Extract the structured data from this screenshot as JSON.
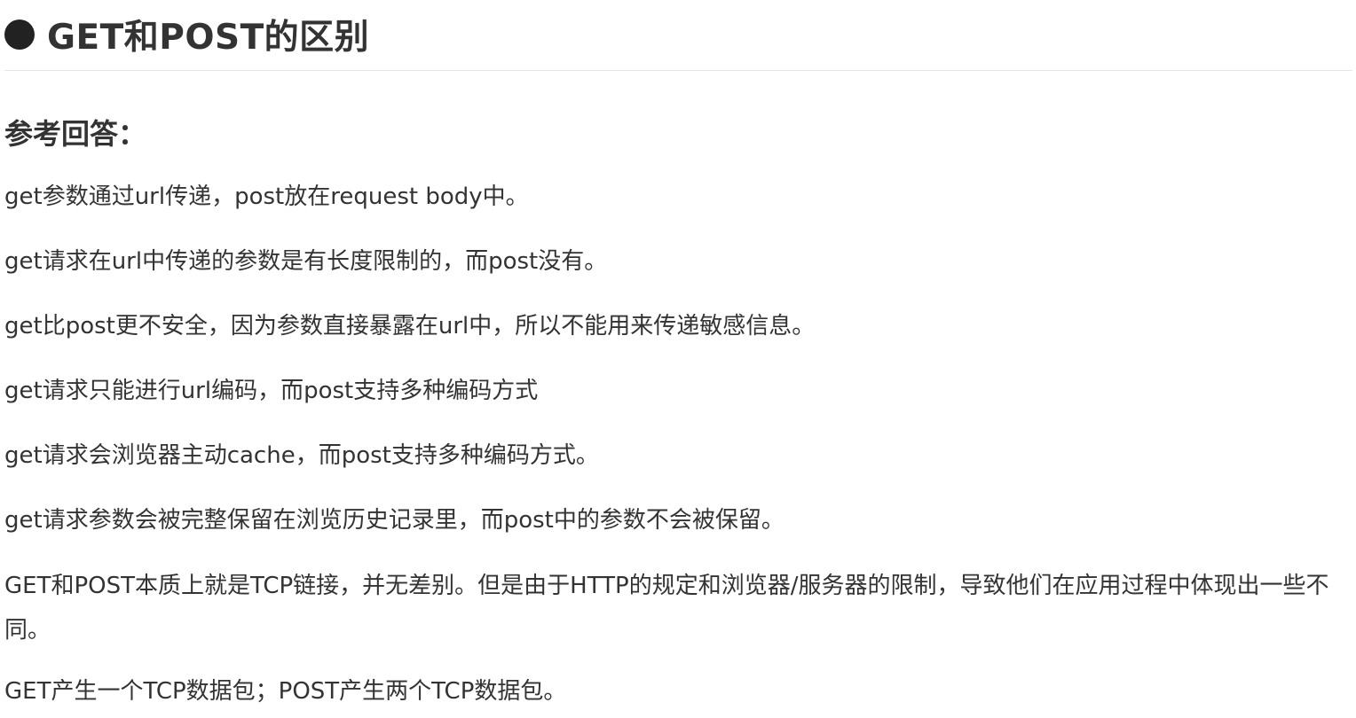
{
  "doc": {
    "title": "GET和POST的区别",
    "subheading": "参考回答：",
    "paragraphs": [
      "get参数通过url传递，post放在request body中。",
      "get请求在url中传递的参数是有长度限制的，而post没有。",
      "get比post更不安全，因为参数直接暴露在url中，所以不能用来传递敏感信息。",
      "get请求只能进行url编码，而post支持多种编码方式",
      "get请求会浏览器主动cache，而post支持多种编码方式。",
      "get请求参数会被完整保留在浏览历史记录里，而post中的参数不会被保留。",
      "GET和POST本质上就是TCP链接，并无差别。但是由于HTTP的规定和浏览器/服务器的限制，导致他们在应用过程中体现出一些不同。",
      "GET产生一个TCP数据包；POST产生两个TCP数据包。"
    ]
  }
}
